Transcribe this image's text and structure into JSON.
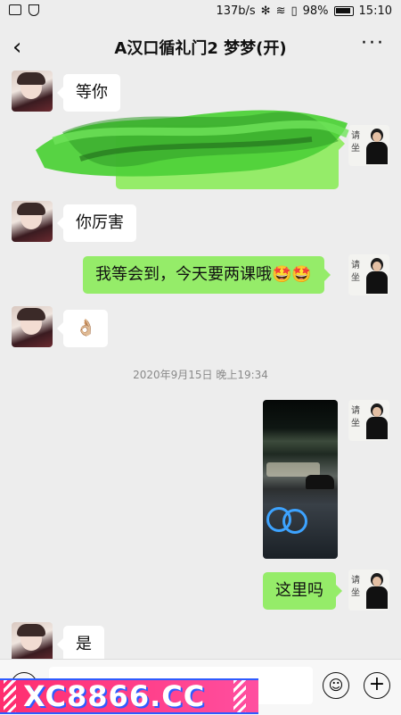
{
  "status": {
    "network_speed": "137b/s",
    "battery": "98%",
    "time": "15:10"
  },
  "header": {
    "back_icon": "chevron-left-icon",
    "title": "A汉口循礼门2 梦梦(开)",
    "more_icon": "more-dots-icon"
  },
  "messages": [
    {
      "side": "in",
      "text": "等你"
    },
    {
      "side": "out",
      "text": "",
      "redacted": true
    },
    {
      "side": "in",
      "text": "你厉害"
    },
    {
      "side": "out",
      "text": "我等会到，今天要两课哦🤩🤩"
    },
    {
      "side": "in",
      "text": "👌🏼"
    },
    {
      "timestamp": "2020年9月15日 晚上19:34"
    },
    {
      "side": "out",
      "image": "night-street-photo"
    },
    {
      "side": "out",
      "text": "这里吗"
    },
    {
      "side": "in",
      "text": "是"
    }
  ],
  "my_avatar_caption": "请坐",
  "input": {
    "voice_icon": "voice-icon",
    "emoji_icon": "emoji-icon",
    "plus_icon": "plus-icon",
    "placeholder": ""
  },
  "watermark": {
    "text": "XC8866.CC"
  },
  "colors": {
    "bg": "#ededed",
    "out_bubble": "#95ec69",
    "in_bubble": "#ffffff",
    "watermark": "#ff2d6f"
  }
}
